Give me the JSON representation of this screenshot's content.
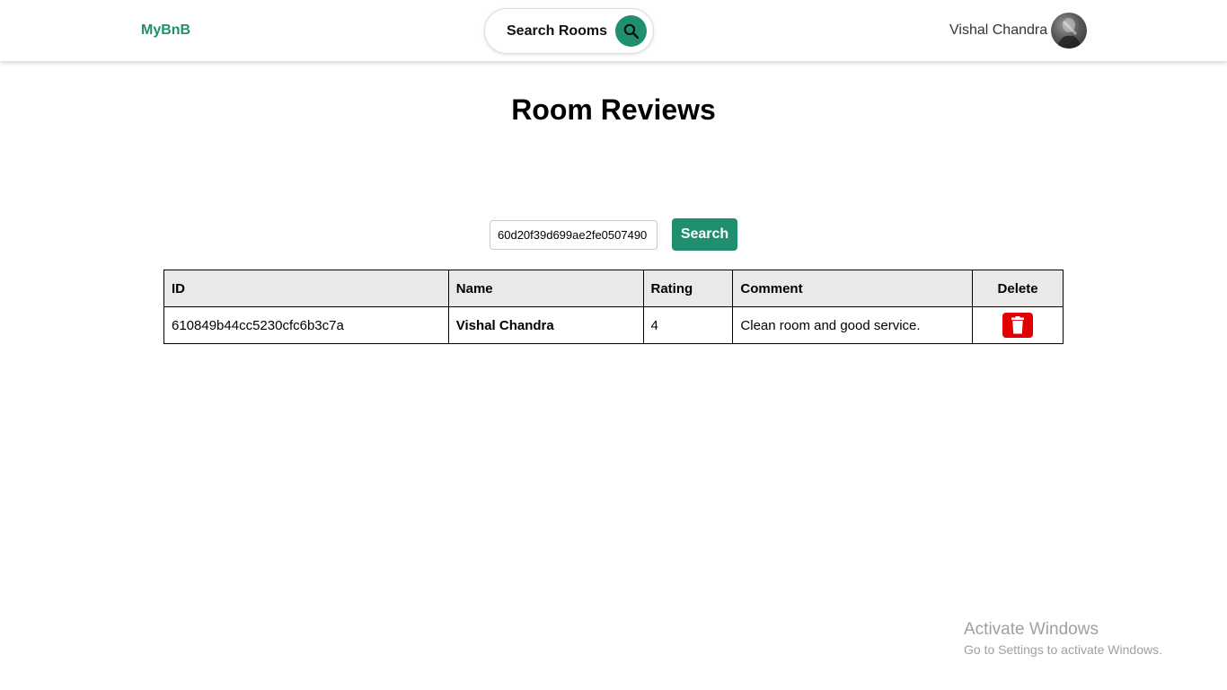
{
  "nav": {
    "brand": "MyBnB",
    "search_label": "Search Rooms",
    "user_name": "Vishal Chandra",
    "accent_color": "#1f8f6f"
  },
  "page": {
    "title": "Room Reviews"
  },
  "search": {
    "room_id_value": "60d20f39d699ae2fe0507490",
    "button_label": "Search"
  },
  "table": {
    "headers": {
      "id": "ID",
      "name": "Name",
      "rating": "Rating",
      "comment": "Comment",
      "delete": "Delete"
    },
    "rows": [
      {
        "id": "610849b44cc5230cfc6b3c7a",
        "name": "Vishal Chandra",
        "rating": "4",
        "comment": "Clean room and good service."
      }
    ],
    "delete_color": "#e00000"
  },
  "watermark": {
    "title": "Activate Windows",
    "subtitle": "Go to Settings to activate Windows."
  }
}
